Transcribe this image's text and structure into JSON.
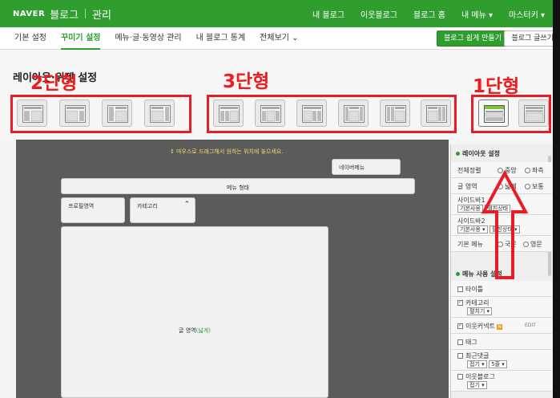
{
  "topbar": {
    "brand": "NAVER",
    "brand_sub": "블로그",
    "admin": "관리",
    "links": [
      "내 블로그",
      "이웃블로그",
      "블로그 홈",
      "내 메뉴 ▾",
      "마스터키 ▾"
    ]
  },
  "subnav": {
    "tabs": [
      "기본 설정",
      "꾸미기 설정",
      "메뉴·글·동영상 관리",
      "내 블로그 통계",
      "전체보기 ⌄"
    ],
    "btn_easy": "블로그 쉽게 만들기",
    "btn_write": "블로그 글쓰기"
  },
  "layout": {
    "title": "레이아웃·위젯 설정",
    "annotations": {
      "two_col": "2단형",
      "three_col": "3단형",
      "one_col": "1단형"
    }
  },
  "canvas": {
    "hint": "↕ 마우스로 드래그해서 원하는 위치에 놓으세요.",
    "neighbor_menu": "네이버메뉴",
    "menu_bar": "메뉴 형태",
    "profile": "프로필영역",
    "category": "카테고리",
    "category_caret": "⌃",
    "post_area": "글 영역",
    "post_area_sub": "(넓게)"
  },
  "panel": {
    "layout_settings": "레이아웃 설정",
    "align": {
      "label": "전체정렬",
      "opt1": "중앙",
      "opt2": "좌측"
    },
    "post_area": {
      "label": "글 영역",
      "opt1": "넓게",
      "opt2": "보통"
    },
    "sidebar1": {
      "label": "사이드바1",
      "sel1": "기본사용",
      "sel2": "펼친상태"
    },
    "sidebar2": {
      "label": "사이드바2",
      "sel1": "기본사용 ▾",
      "sel2": "펼친상태 ▾"
    },
    "basic_menu": {
      "label": "기본 메뉴",
      "opt1": "국문",
      "opt2": "영문"
    },
    "menu_settings": "메뉴 사용 설정",
    "items": [
      {
        "label": "타이틀",
        "sub": ""
      },
      {
        "label": "카테고리",
        "sub": "펼치기 ▾"
      },
      {
        "label": "이웃커넥트",
        "sub": "",
        "badge": "N",
        "edit": "EDIT"
      },
      {
        "label": "태그",
        "sub": ""
      },
      {
        "label": "최근댓글",
        "sub": "접기 ▾",
        "sub2": "5줄 ▾"
      },
      {
        "label": "이웃블로그",
        "sub": "접기 ▾"
      }
    ]
  },
  "colors": {
    "naver_green": "#2f9e2f",
    "annotation_red": "#e81c24"
  }
}
